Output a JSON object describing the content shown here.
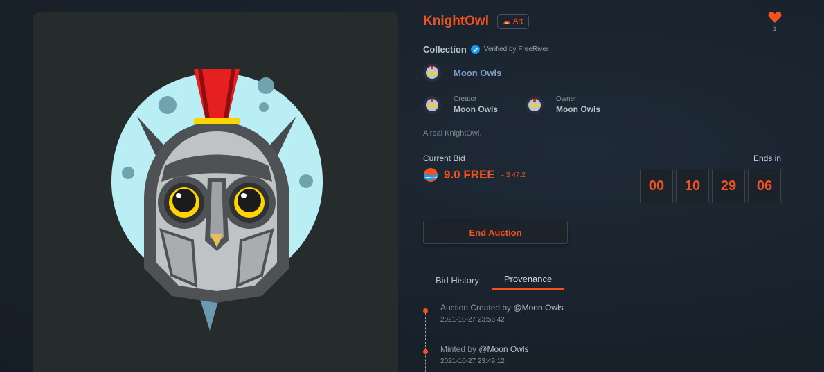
{
  "asset": {
    "title": "KnightOwl",
    "category": "Art",
    "likes": "1",
    "description": "A real KnightOwl."
  },
  "collection": {
    "label": "Collection",
    "verified_text": "Verified by FreeRiver",
    "name": "Moon Owls"
  },
  "creator": {
    "role": "Creator",
    "name": "Moon Owls"
  },
  "owner": {
    "role": "Owner",
    "name": "Moon Owls"
  },
  "bid": {
    "label": "Current Bid",
    "value": "9.0 FREE",
    "usd": "≈ $ 47.2"
  },
  "auction": {
    "ends_label": "Ends in",
    "timer": [
      "00",
      "10",
      "29",
      "06"
    ],
    "end_button": "End Auction"
  },
  "tabs": [
    {
      "label": "Bid History",
      "active": false
    },
    {
      "label": "Provenance",
      "active": true
    }
  ],
  "provenance": [
    {
      "action": "Auction Created by ",
      "user": "@Moon Owls",
      "timestamp": "2021-10-27 23:56:42"
    },
    {
      "action": "Minted by ",
      "user": "@Moon Owls",
      "timestamp": "2021-10-27 23:49:12"
    }
  ],
  "colors": {
    "accent": "#f4511e",
    "verified": "#1d9bf0",
    "background": "#19222c",
    "panel": "#262c2b"
  }
}
